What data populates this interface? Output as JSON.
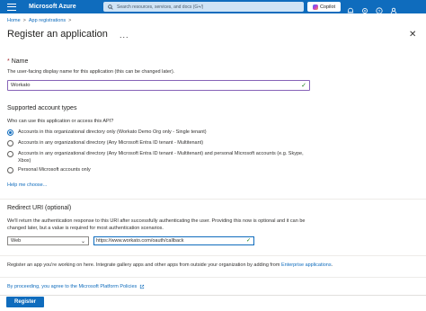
{
  "header": {
    "brand": "Microsoft Azure",
    "search_placeholder": "Search resources, services, and docs (G+/)",
    "copilot_label": "Copilot",
    "icons": [
      "notifications-icon",
      "settings-icon",
      "help-icon",
      "feedback-icon"
    ]
  },
  "breadcrumb": {
    "home": "Home",
    "separator": ">",
    "app_registrations": "App registrations",
    "separator2": ">"
  },
  "page": {
    "title": "Register an application",
    "more_label": "...",
    "close_label": "✕"
  },
  "name_section": {
    "required_marker": "*",
    "label": "Name",
    "helper": "The user-facing display name for this application (this can be changed later).",
    "value": "Workato"
  },
  "account_types": {
    "heading": "Supported account types",
    "question": "Who can use this application or access this API?",
    "options": [
      {
        "label": "Accounts in this organizational directory only (Workato Demo Org only - Single tenant)",
        "selected": true
      },
      {
        "label": "Accounts in any organizational directory (Any Microsoft Entra ID tenant - Multitenant)",
        "selected": false
      },
      {
        "label": "Accounts in any organizational directory (Any Microsoft Entra ID tenant - Multitenant) and personal Microsoft accounts (e.g. Skype, Xbox)",
        "selected": false
      },
      {
        "label": "Personal Microsoft accounts only",
        "selected": false
      }
    ],
    "help_link": "Help me choose..."
  },
  "redirect": {
    "heading": "Redirect URI (optional)",
    "helper": "We'll return the authentication response to this URI after successfully authenticating the user. Providing this now is optional and it can be changed later, but a value is required for most authentication scenarios.",
    "platform": "Web",
    "uri": "https://www.workato.com/oauth/callback"
  },
  "register_info": {
    "text": "Register an app you're working on here. Integrate gallery apps and other apps from outside your organization by adding from",
    "link": "Enterprise applications",
    "period": "."
  },
  "policy": {
    "text": "By proceeding, you agree to the Microsoft Platform Policies"
  },
  "footer": {
    "register_button": "Register"
  },
  "colors": {
    "accent": "#0f6cbd",
    "focus_border": "#8764b8",
    "required": "#a4262c",
    "valid": "#107c10"
  }
}
